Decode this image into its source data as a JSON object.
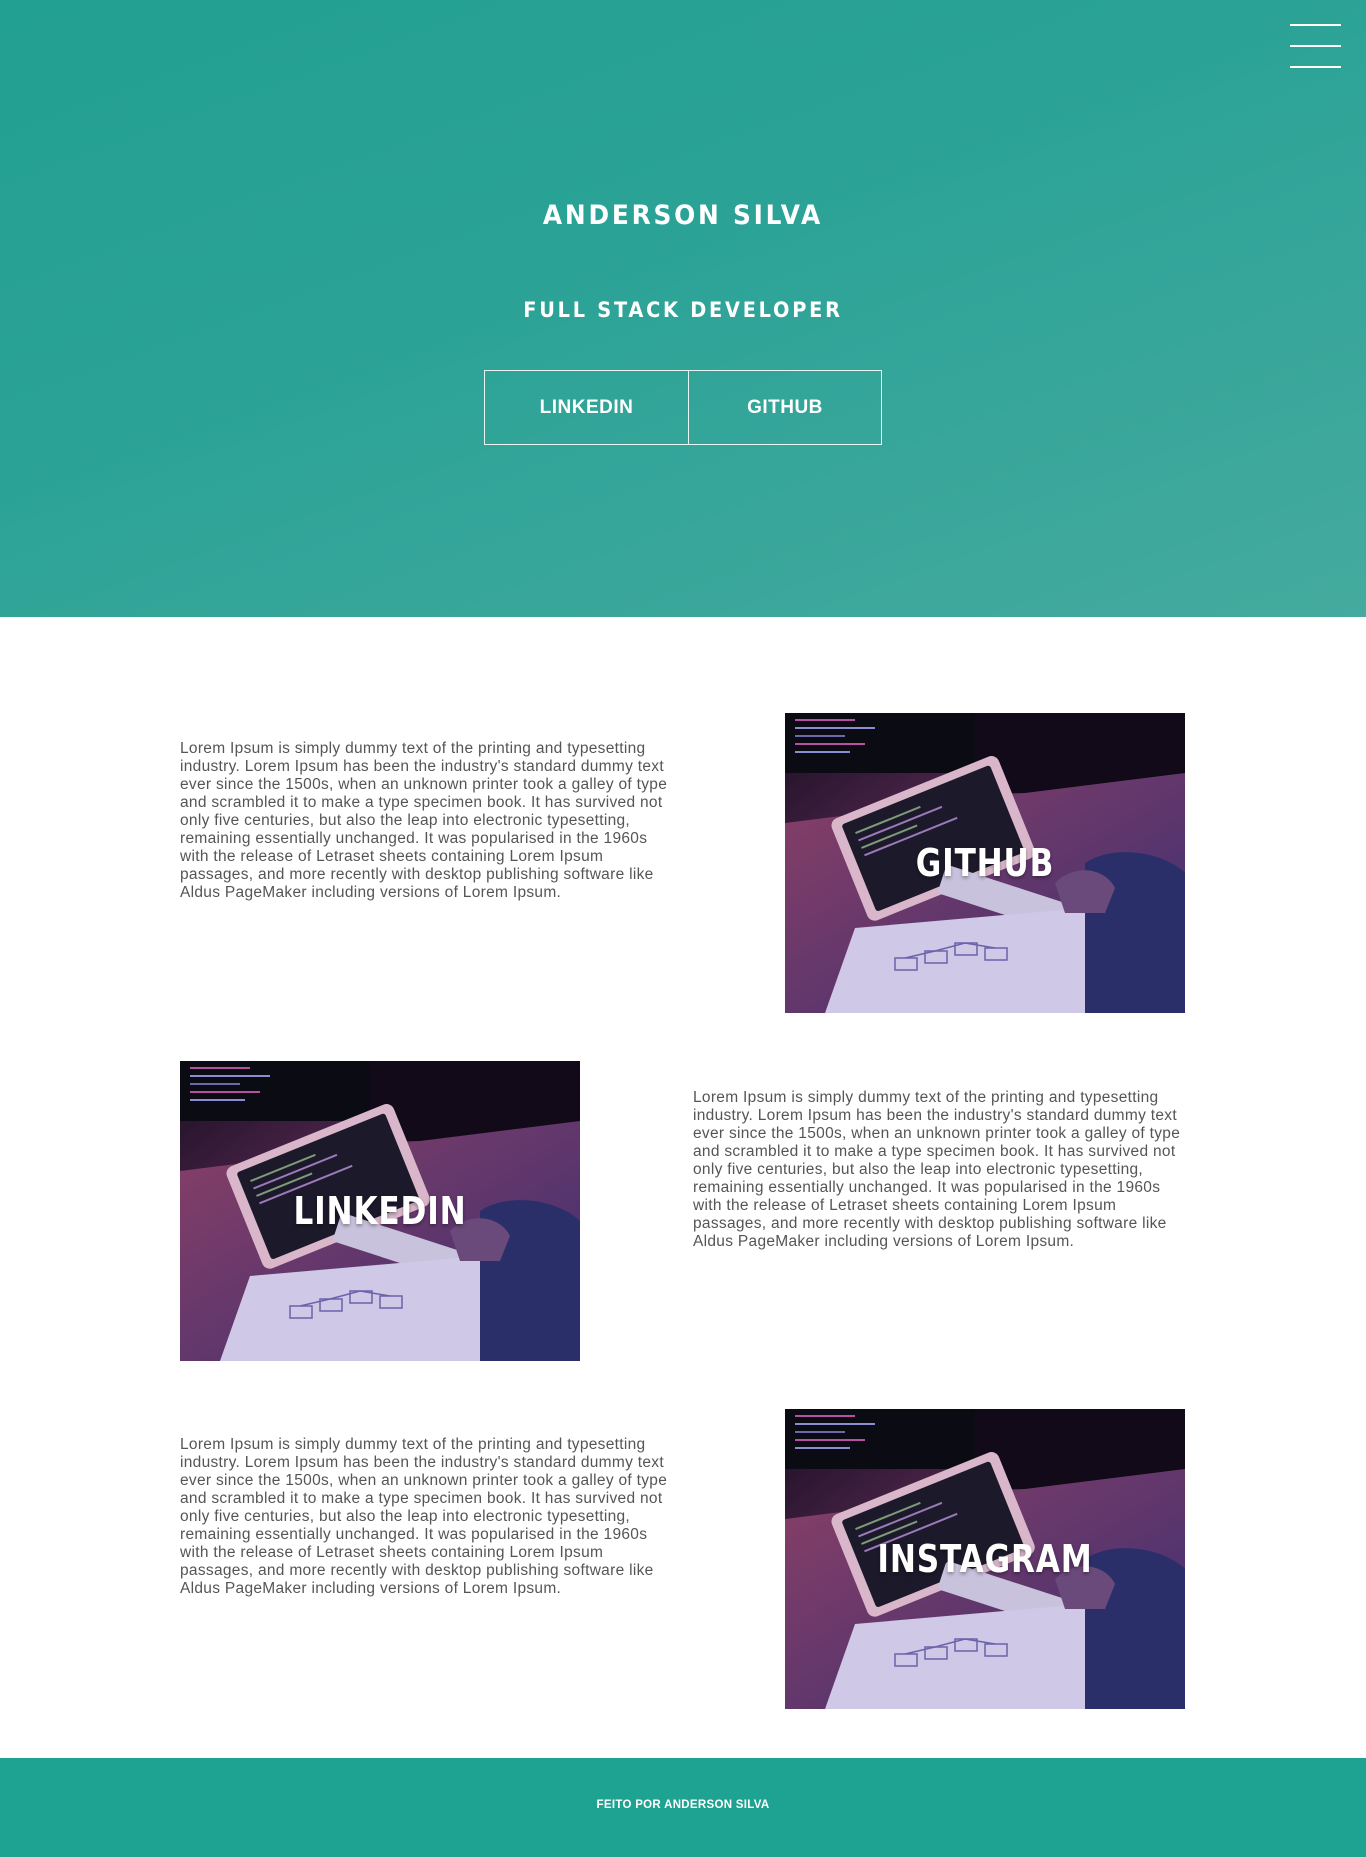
{
  "hero": {
    "name": "ANDERSON SILVA",
    "role": "FULL STACK DEVELOPER",
    "buttons": {
      "linkedin": "LINKEDIN",
      "github": "GITHUB"
    },
    "menu_icon": "hamburger-menu-icon"
  },
  "sections": [
    {
      "text": "Lorem Ipsum is simply dummy text of the printing and typesetting industry. Lorem Ipsum has been the industry's standard dummy text ever since the 1500s, when an unknown printer took a galley of type and scrambled it to make a type specimen book. It has survived not only five centuries, but also the leap into electronic typesetting, remaining essentially unchanged. It was popularised in the 1960s with the release of Letraset sheets containing Lorem Ipsum passages, and more recently with desktop publishing software like Aldus PageMaker including versions of Lorem Ipsum.",
      "card_label": "GITHUB"
    },
    {
      "text": "Lorem Ipsum is simply dummy text of the printing and typesetting industry. Lorem Ipsum has been the industry's standard dummy text ever since the 1500s, when an unknown printer took a galley of type and scrambled it to make a type specimen book. It has survived not only five centuries, but also the leap into electronic typesetting, remaining essentially unchanged. It was popularised in the 1960s with the release of Letraset sheets containing Lorem Ipsum passages, and more recently with desktop publishing software like Aldus PageMaker including versions of Lorem Ipsum.",
      "card_label": "LINKEDIN"
    },
    {
      "text": "Lorem Ipsum is simply dummy text of the printing and typesetting industry. Lorem Ipsum has been the industry's standard dummy text ever since the 1500s, when an unknown printer took a galley of type and scrambled it to make a type specimen book. It has survived not only five centuries, but also the leap into electronic typesetting, remaining essentially unchanged. It was popularised in the 1960s with the release of Letraset sheets containing Lorem Ipsum passages, and more recently with desktop publishing software like Aldus PageMaker including versions of Lorem Ipsum.",
      "card_label": "INSTAGRAM"
    }
  ],
  "footer": {
    "text": "FEITO POR ANDERSON SILVA"
  },
  "colors": {
    "hero_bg": "#2aa296",
    "footer_bg": "#1ea291",
    "body_text": "#555555",
    "text_light": "#ffffff"
  }
}
